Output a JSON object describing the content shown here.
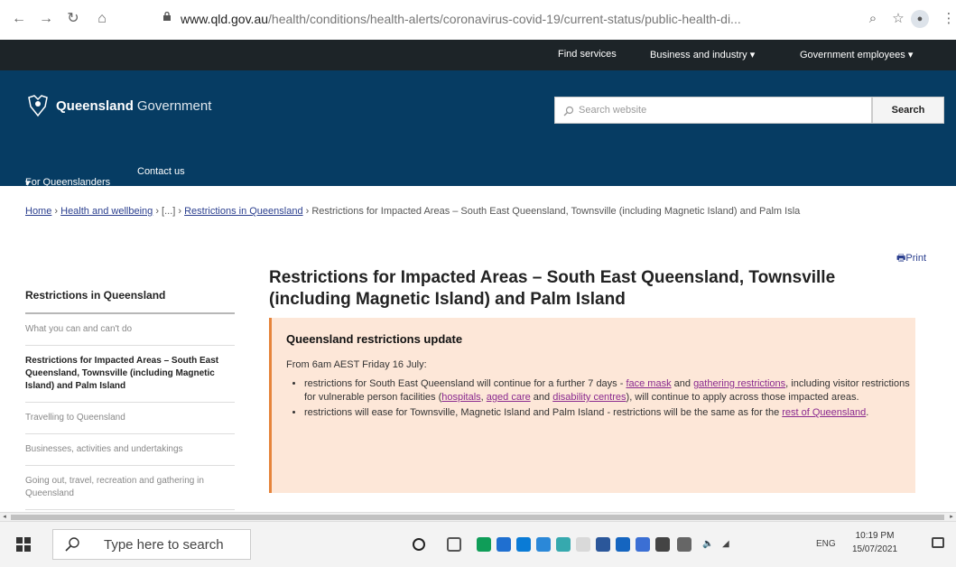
{
  "browser": {
    "url_host": "www.qld.gov.au",
    "url_path": "/health/conditions/health-alerts/coronavirus-covid-19/current-status/public-health-di..."
  },
  "topbar": {
    "find_services": "Find services",
    "business": "Business and industry",
    "gov_employees": "Government employees"
  },
  "header": {
    "logo_bold": "Queensland",
    "logo_rest": "Government",
    "search_placeholder": "Search website",
    "search_button": "Search",
    "nav_for_qlders": "For Queenslanders",
    "nav_contact": "Contact us"
  },
  "breadcrumb": {
    "home": "Home",
    "health": "Health and wellbeing",
    "ellipsis": "[...]",
    "restrictions": "Restrictions in Queensland",
    "current": "Restrictions for Impacted Areas – South East Queensland, Townsville (including Magnetic Island) and Palm Isla"
  },
  "print_label": "Print",
  "sidebar": {
    "heading": "Restrictions in Queensland",
    "items": [
      "What you can and can't do",
      "Restrictions for Impacted Areas – South East Queensland, Townsville (including Magnetic Island) and Palm Island",
      "Travelling to Queensland",
      "Businesses, activities and undertakings",
      "Going out, travel, recreation and gathering in Queensland"
    ]
  },
  "main": {
    "title": "Restrictions for Impacted Areas – South East Queensland, Townsville (including Magnetic Island) and Palm Island",
    "alert_title": "Queensland restrictions update",
    "alert_from": "From 6am AEST Friday 16 July:",
    "b1_pre": "restrictions for South East Queensland will continue for a further 7 days - ",
    "b1_link1": "face mask",
    "b1_mid1": " and ",
    "b1_link2": "gathering restrictions",
    "b1_mid2": ", including visitor restrictions for vulnerable person facilities (",
    "b1_link3": "hospitals",
    "b1_mid3": ", ",
    "b1_link4": "aged care",
    "b1_mid4": " and ",
    "b1_link5": "disability centres",
    "b1_post": "), will continue to apply across those impacted areas.",
    "b2_pre": "restrictions will ease for Townsville, Magnetic Island and Palm Island - restrictions will be the same as for the ",
    "b2_link": "rest of Queensland",
    "b2_post": "."
  },
  "taskbar": {
    "search_placeholder": "Type here to search",
    "lang": "ENG",
    "time": "10:19 PM",
    "date": "15/07/2021"
  }
}
